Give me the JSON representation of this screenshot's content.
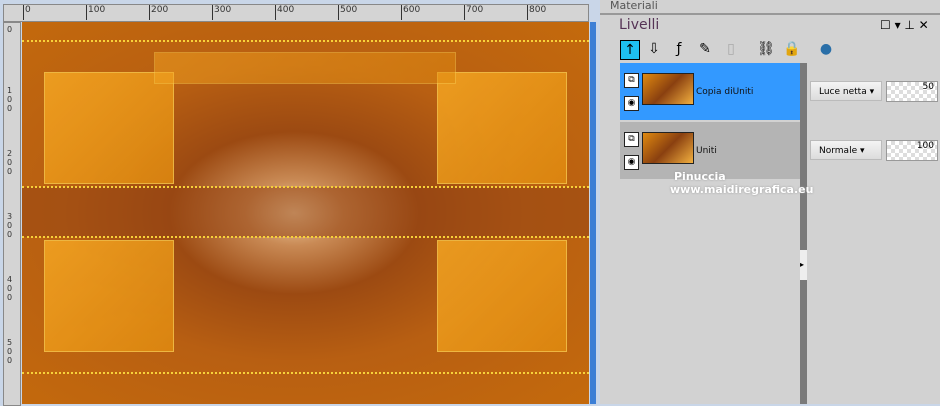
{
  "ruler": {
    "top_labels": [
      "0",
      "100",
      "200",
      "300",
      "400",
      "500",
      "600",
      "700",
      "800"
    ],
    "left_labels": [
      "0",
      "100",
      "200",
      "300",
      "400",
      "500"
    ]
  },
  "panel": {
    "materials_title": "Materiali",
    "title": "Livelli",
    "toolbar": [
      "move-up-icon",
      "move-down-icon",
      "new-layer-icon",
      "paint-layer-icon",
      "mask-icon",
      "link-icon",
      "lock-icon",
      "merge-icon"
    ],
    "layers": [
      {
        "name": "Copia diUniti",
        "blend": "Luce netta",
        "opacity": "50",
        "selected": true
      },
      {
        "name": "Uniti",
        "blend": "Normale",
        "opacity": "100",
        "selected": false
      }
    ]
  },
  "watermark": {
    "line1": "Pinuccia",
    "line2": "www.maidiregrafica.eu"
  },
  "colors": {
    "selected": "#3399ff",
    "accent": "#3c7fd6"
  }
}
